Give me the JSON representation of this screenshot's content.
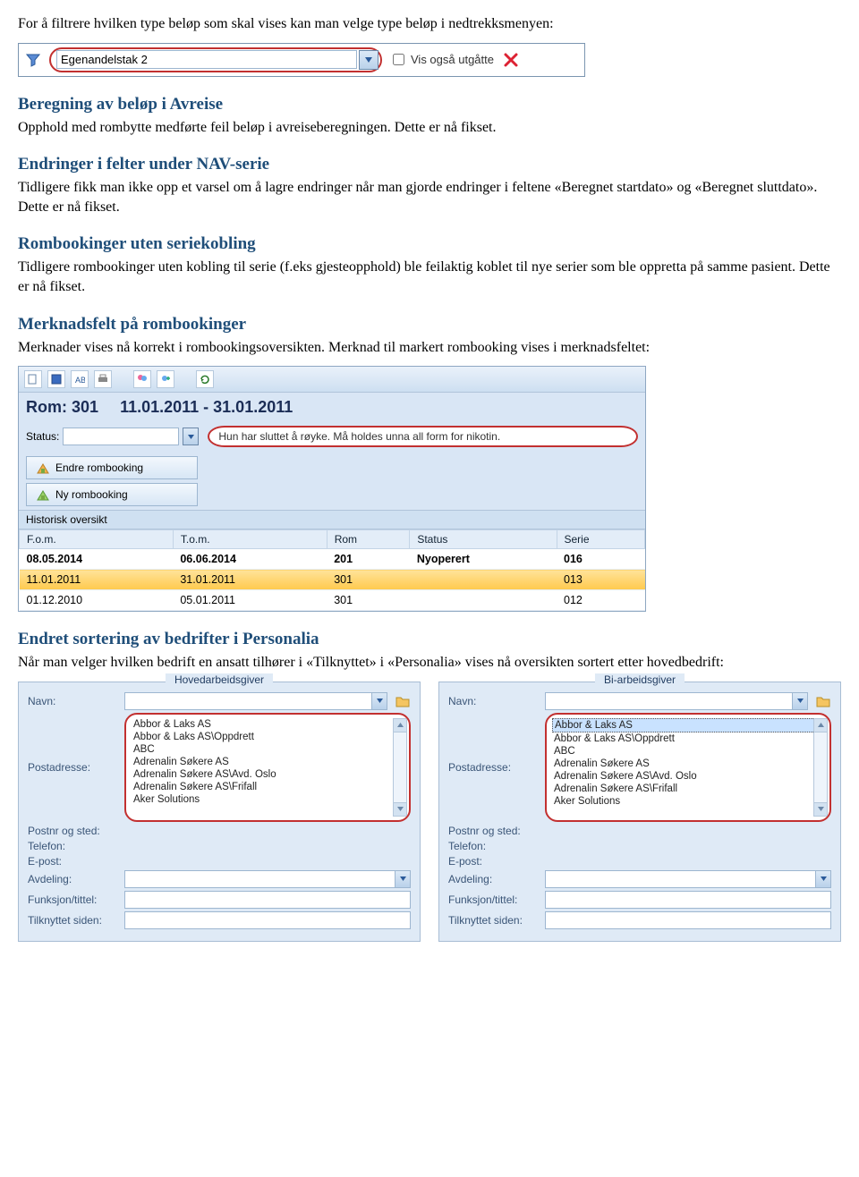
{
  "intro_text": "For å filtrere hvilken type beløp som skal vises kan man velge type beløp i nedtrekksmenyen:",
  "filterbar": {
    "dropdown_value": "Egenandelstak 2",
    "show_expired_label": "Vis også utgåtte"
  },
  "sections": {
    "avreise": {
      "heading": "Beregning av beløp i Avreise",
      "body": "Opphold med rombytte medførte feil beløp i avreiseberegningen. Dette er nå fikset."
    },
    "nav": {
      "heading": "Endringer i felter under NAV-serie",
      "body": "Tidligere fikk man ikke opp et varsel om å lagre endringer når man gjorde endringer i feltene «Beregnet startdato» og «Beregnet sluttdato». Dette er nå fikset."
    },
    "serie": {
      "heading": "Rombookinger uten seriekobling",
      "body": "Tidligere rombookinger uten kobling til serie (f.eks gjesteopphold) ble feilaktig koblet til nye serier som ble oppretta på samme pasient. Dette er nå fikset."
    },
    "merknad": {
      "heading": "Merknadsfelt på rombookinger",
      "body": "Merknader vises nå korrekt i rombookingsoversikten. Merknad til markert rombooking vises i merknadsfeltet:"
    },
    "sortering": {
      "heading": "Endret sortering av bedrifter i Personalia",
      "body": "Når man velger hvilken bedrift en ansatt tilhører i «Tilknyttet» i «Personalia» vises nå oversikten sortert etter hovedbedrift:"
    }
  },
  "panel": {
    "room_label": "Rom:",
    "room_no": "301",
    "date_range": "11.01.2011  -  31.01.2011",
    "status_label": "Status:",
    "note_text": "Hun har sluttet å røyke. Må holdes unna all form for nikotin.",
    "btn_endre": "Endre rombooking",
    "btn_ny": "Ny rombooking",
    "history_label": "Historisk oversikt",
    "columns": {
      "fom": "F.o.m.",
      "tom": "T.o.m.",
      "rom": "Rom",
      "status": "Status",
      "serie": "Serie"
    },
    "rows": [
      {
        "fom": "08.05.2014",
        "tom": "06.06.2014",
        "rom": "201",
        "status": "Nyoperert",
        "serie": "016",
        "bold": true
      },
      {
        "fom": "11.01.2011",
        "tom": "31.01.2011",
        "rom": "301",
        "status": "",
        "serie": "013",
        "selected": true
      },
      {
        "fom": "01.12.2010",
        "tom": "05.01.2011",
        "rom": "301",
        "status": "",
        "serie": "012"
      }
    ]
  },
  "form": {
    "hoved_legend": "Hovedarbeidsgiver",
    "bi_legend": "Bi-arbeidsgiver",
    "labels": {
      "navn": "Navn:",
      "post": "Postadresse:",
      "postnr": "Postnr og sted:",
      "telefon": "Telefon:",
      "epost": "E-post:",
      "avdeling": "Avdeling:",
      "funksjon": "Funksjon/tittel:",
      "tilknyttet": "Tilknyttet siden:"
    },
    "list_items": [
      "Abbor & Laks AS",
      "Abbor & Laks AS\\Oppdrett",
      "ABC",
      "Adrenalin Søkere AS",
      "Adrenalin Søkere AS\\Avd. Oslo",
      "Adrenalin Søkere AS\\Frifall",
      "Aker Solutions"
    ]
  }
}
